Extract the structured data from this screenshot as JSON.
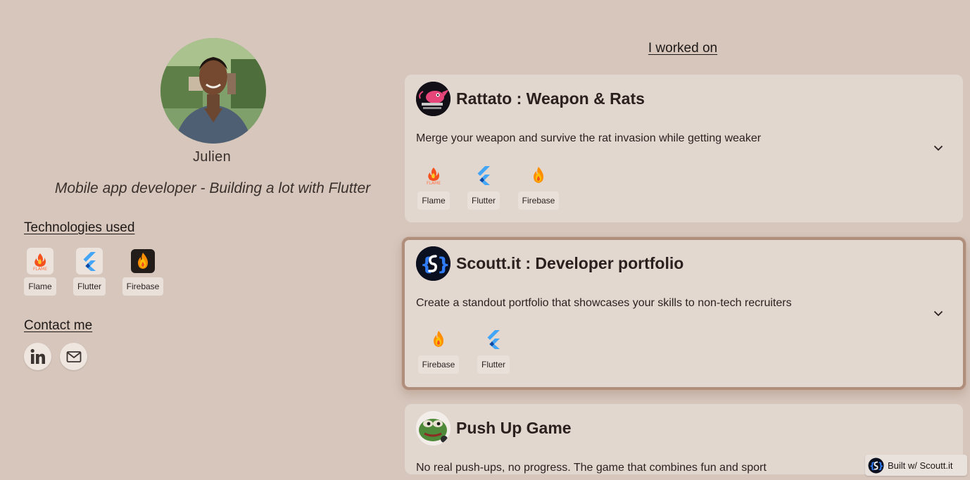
{
  "profile": {
    "name": "Julien",
    "tagline": "Mobile app developer - Building a lot with Flutter"
  },
  "technologies": {
    "title": "Technologies used",
    "items": [
      {
        "label": "Flame",
        "icon": "flame-icon"
      },
      {
        "label": "Flutter",
        "icon": "flutter-icon"
      },
      {
        "label": "Firebase",
        "icon": "firebase-icon"
      }
    ]
  },
  "contact": {
    "title": "Contact me",
    "items": [
      {
        "icon": "linkedin-icon"
      },
      {
        "icon": "mail-icon"
      }
    ]
  },
  "projects": {
    "title": "I worked on",
    "items": [
      {
        "title": "Rattato : Weapon & Rats",
        "description": "Merge your weapon and survive the rat invasion while getting weaker",
        "tech": [
          "Flame",
          "Flutter",
          "Firebase"
        ]
      },
      {
        "title": "Scoutt.it : Developer portfolio",
        "description": "Create a standout portfolio that showcases your skills to non-tech recruiters",
        "tech": [
          "Firebase",
          "Flutter"
        ]
      },
      {
        "title": "Push Up Game",
        "description": "No real push-ups, no progress. The game that combines fun and sport"
      }
    ]
  },
  "footer": {
    "built_label": "Built w/ Scoutt.it"
  },
  "colors": {
    "background": "#d6c6bc",
    "card": "#e2d7cf",
    "highlight_border": "#b08e7c",
    "flutter": "#42a5f5",
    "firebase": "#ff8f00"
  }
}
